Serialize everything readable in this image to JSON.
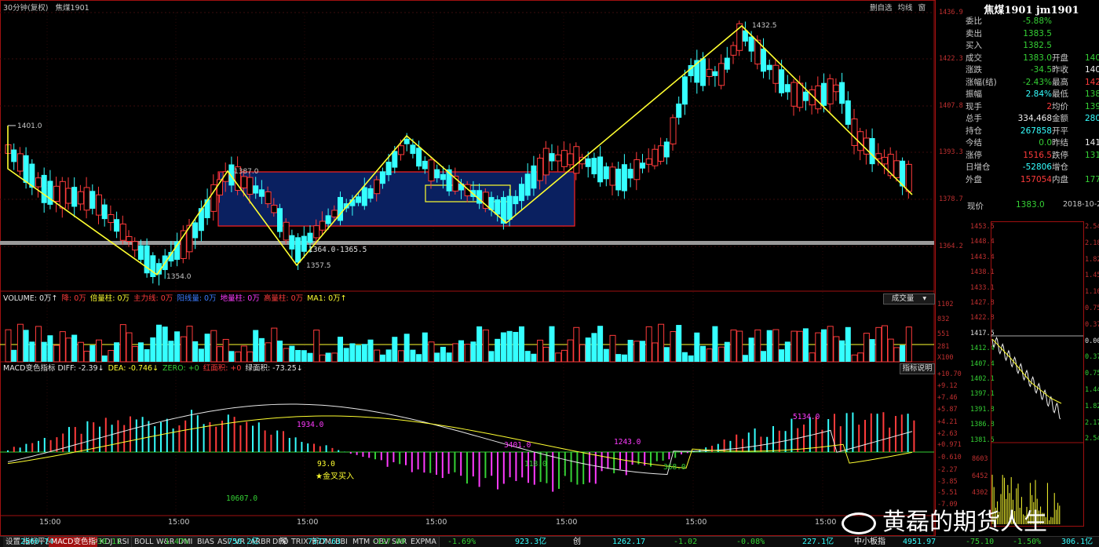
{
  "window": {
    "title": "30分钟(复权)",
    "symbol": "焦煤1901",
    "top_buttons": [
      "删自选",
      "均线",
      "窗"
    ]
  },
  "price_axis": [
    "1436.9",
    "1422.3",
    "1407.8",
    "1393.3",
    "1378.7",
    "1364.2"
  ],
  "annotations": {
    "p1401": "1401.0",
    "p1354": "1354.0",
    "p1387": "1387.0",
    "p1357": "1357.5",
    "zone": "1364.0-1365.5",
    "p1432": "1432.5"
  },
  "volume_header": {
    "items": [
      {
        "text": "VOLUME: 0万↑",
        "color": "#e8e8e8"
      },
      {
        "text": "降: 0万",
        "color": "#ff3b3b"
      },
      {
        "text": "倍量柱: 0万",
        "color": "#ffff30"
      },
      {
        "text": "主力线: 0万",
        "color": "#ff3b3b"
      },
      {
        "text": "阳线量: 0万",
        "color": "#3b7bff"
      },
      {
        "text": "地量柱: 0万",
        "color": "#ff3bff"
      },
      {
        "text": "高量柱: 0万",
        "color": "#ff3b3b"
      },
      {
        "text": "MA1: 0万↑",
        "color": "#ffff30"
      }
    ],
    "button": "成交量"
  },
  "volume_axis": [
    "1102",
    "832",
    "551",
    "281",
    "X100"
  ],
  "macd_header": {
    "items": [
      {
        "text": "MACD变色指标 DIFF: -2.39↓",
        "color": "#e8e8e8"
      },
      {
        "text": "DEA: -0.746↓",
        "color": "#ffff30"
      },
      {
        "text": "ZERO: +0",
        "color": "#35d135"
      },
      {
        "text": "红面积: +0",
        "color": "#ff3b3b"
      },
      {
        "text": "绿面积: -73.25↓",
        "color": "#e8e8e8"
      }
    ],
    "button": "指标说明"
  },
  "macd_axis": [
    "+10.70",
    "+9.12",
    "+7.46",
    "+5.87",
    "+4.21",
    "+2.63",
    "+0.971",
    "-0.610",
    "-2.27",
    "-3.85",
    "-5.51",
    "-7.09"
  ],
  "macd_labels": {
    "a1": "1934.0",
    "a2": "93.0",
    "a3": "金叉买入",
    "a4": "10607.0",
    "a5": "3401.0",
    "a6": "118.0",
    "a7": "1243.0",
    "a8": "368.0",
    "a9": "5134.0"
  },
  "time_labels": [
    "15:00",
    "15:00",
    "15:00",
    "15:00",
    "15:00",
    "15:00",
    "15:00"
  ],
  "quote": {
    "title": "焦煤1901 jm1901",
    "rows": [
      {
        "l1": "委比",
        "v1": "-5.88%",
        "c1": "green"
      },
      {
        "l1": "卖出",
        "v1": "1383.5",
        "c1": "green"
      },
      {
        "l1": "买入",
        "v1": "1382.5",
        "c1": "green"
      },
      {
        "l1": "成交",
        "v1": "1383.0",
        "c1": "green",
        "l2": "开盘",
        "v2": "140",
        "c2": "green"
      },
      {
        "l1": "涨跌",
        "v1": "-34.5",
        "c1": "green",
        "l2": "昨收",
        "v2": "140",
        "c2": "white"
      },
      {
        "l1": "涨幅(结)",
        "v1": "-2.43%",
        "c1": "green",
        "l2": "最高",
        "v2": "142",
        "c2": "red"
      },
      {
        "l1": "振幅",
        "v1": "2.84%",
        "c1": "cyan",
        "l2": "最低",
        "v2": "138",
        "c2": "green"
      },
      {
        "l1": "现手",
        "v1": "2",
        "c1": "red",
        "l2": "均价",
        "v2": "139",
        "c2": "green"
      },
      {
        "l1": "总手",
        "v1": "334,468",
        "c1": "white",
        "l2": "金额",
        "v2": "280.8",
        "c2": "cyan"
      },
      {
        "l1": "持仓",
        "v1": "267858",
        "c1": "cyan",
        "l2": "开平",
        "v2": "",
        "c2": "white"
      },
      {
        "l1": "今结",
        "v1": "0.0",
        "c1": "green",
        "l2": "昨结",
        "v2": "141",
        "c2": "white"
      },
      {
        "l1": "涨停",
        "v1": "1516.5",
        "c1": "red",
        "l2": "跌停",
        "v2": "131",
        "c2": "green"
      },
      {
        "l1": "日增仓",
        "v1": "-52806",
        "c1": "cyan",
        "l2": "增仓",
        "v2": "",
        "c2": "white"
      },
      {
        "l1": "外盘",
        "v1": "157054",
        "c1": "red",
        "l2": "内盘",
        "v2": "1774",
        "c2": "green"
      }
    ],
    "now_label": "现价",
    "now_value": "1383.0",
    "now_date": "2018-10-29",
    "mini_left": [
      "1453.5",
      "1448.4",
      "1443.4",
      "1438.1",
      "1433.1",
      "1427.8",
      "1422.8",
      "1417.5",
      "1412.4",
      "1407.4",
      "1402.1",
      "1397.1",
      "1391.8",
      "1386.8",
      "1381.5"
    ],
    "mini_right": [
      "2.54",
      "2.18",
      "1.82",
      "1.45",
      "1.10",
      "0.75",
      "0.37",
      "0.00",
      "0.37",
      "0.75",
      "1.44",
      "1.82",
      "2.17",
      "2.54"
    ],
    "mini_vol": [
      "8603",
      "6452",
      "4302"
    ]
  },
  "bottom": {
    "tabs": [
      "设置",
      "指标平台",
      "MACD变色指标",
      "KDJ",
      "RSI",
      "BOLL",
      "W&R",
      "DMI",
      "BIAS",
      "ASI",
      "VR",
      "ARBR",
      "DPO",
      "TRIX",
      "新DMA",
      "BBI",
      "MTM",
      "OBV",
      "SAR",
      "EXPMA"
    ],
    "active_tab": "MACD变色指标",
    "ticker": [
      {
        "t": "2560.74",
        "c": "cyan"
      },
      {
        "t": "-30.11",
        "c": "green"
      },
      {
        "t": "-1.47%",
        "c": "green"
      },
      {
        "t": "750.2亿",
        "c": "cyan"
      },
      {
        "t": "深",
        "c": "white"
      },
      {
        "t": "7377.63",
        "c": "cyan"
      },
      {
        "t": "-127.09",
        "c": "green"
      },
      {
        "t": "-1.69%",
        "c": "green"
      },
      {
        "t": "923.3亿",
        "c": "cyan"
      },
      {
        "t": "创",
        "c": "white"
      },
      {
        "t": "1262.17",
        "c": "cyan"
      },
      {
        "t": "-1.02",
        "c": "green"
      },
      {
        "t": "-0.08%",
        "c": "green"
      },
      {
        "t": "227.1亿",
        "c": "cyan"
      },
      {
        "t": "中小板指",
        "c": "white"
      },
      {
        "t": "4951.97",
        "c": "cyan"
      },
      {
        "t": "-75.10",
        "c": "green"
      },
      {
        "t": "-1.50%",
        "c": "green"
      },
      {
        "t": "306.1亿",
        "c": "cyan"
      }
    ]
  },
  "watermark": "黄磊的期货人生"
}
